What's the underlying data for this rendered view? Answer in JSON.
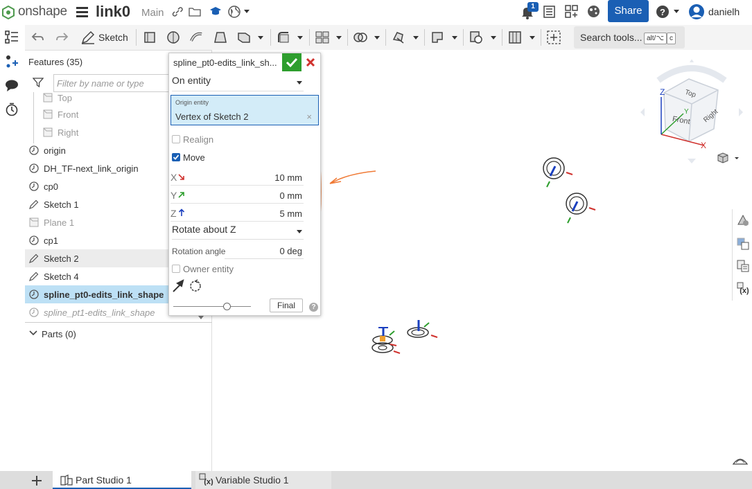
{
  "header": {
    "logo_text": "onshape",
    "document_title": "link0",
    "branch": "Main",
    "notification_count": "1",
    "share_label": "Share",
    "user_name": "danielh"
  },
  "toolbar": {
    "sketch_label": "Sketch",
    "search_label": "Search tools...",
    "shortcut_1": "alt/⌥",
    "shortcut_2": "c"
  },
  "features": {
    "title": "Features (35)",
    "filter_placeholder": "Filter by name or type",
    "items": [
      {
        "label": "Top",
        "icon": "plane-icon"
      },
      {
        "label": "Front",
        "icon": "plane-icon"
      },
      {
        "label": "Right",
        "icon": "plane-icon"
      },
      {
        "label": "origin",
        "icon": "mate-connector-icon"
      },
      {
        "label": "DH_TF-next_link_origin",
        "icon": "mate-connector-icon"
      },
      {
        "label": "cp0",
        "icon": "mate-connector-icon"
      },
      {
        "label": "Sketch 1",
        "icon": "sketch-icon"
      },
      {
        "label": "Plane 1",
        "icon": "plane-icon"
      },
      {
        "label": "cp1",
        "icon": "mate-connector-icon"
      },
      {
        "label": "Sketch 2",
        "icon": "sketch-icon"
      },
      {
        "label": "Sketch 4",
        "icon": "sketch-icon"
      },
      {
        "label": "spline_pt0-edits_link_shape",
        "icon": "mate-connector-icon"
      },
      {
        "label": "spline_pt1-edits_link_shape",
        "icon": "mate-connector-icon"
      }
    ],
    "parts_label": "Parts (0)"
  },
  "dialog": {
    "title": "spline_pt0-edits_link_sh...",
    "mode_value": "On entity",
    "origin_label": "Origin entity",
    "origin_value": "Vertex of Sketch 2",
    "realign_label": "Realign",
    "move_label": "Move",
    "x_label": "X",
    "x_value": "10 mm",
    "y_label": "Y",
    "y_value": "0 mm",
    "z_label": "Z",
    "z_value": "5 mm",
    "rotate_value": "Rotate about Z",
    "rotation_label": "Rotation angle",
    "rotation_value": "0 deg",
    "owner_label": "Owner entity",
    "final_label": "Final",
    "help_label": "?"
  },
  "viewcube": {
    "top": "Top",
    "front": "Front",
    "right": "Right",
    "axis_x": "X",
    "axis_y": "Y",
    "axis_z": "Z"
  },
  "tabs": [
    {
      "label": "Part Studio 1"
    },
    {
      "label": "Variable Studio 1"
    }
  ],
  "colors": {
    "accent": "#1a5fb4",
    "confirm": "#2e9e2e",
    "cancel": "#d0312d",
    "selection": "#bde0f5",
    "annotation": "#f07a35"
  }
}
